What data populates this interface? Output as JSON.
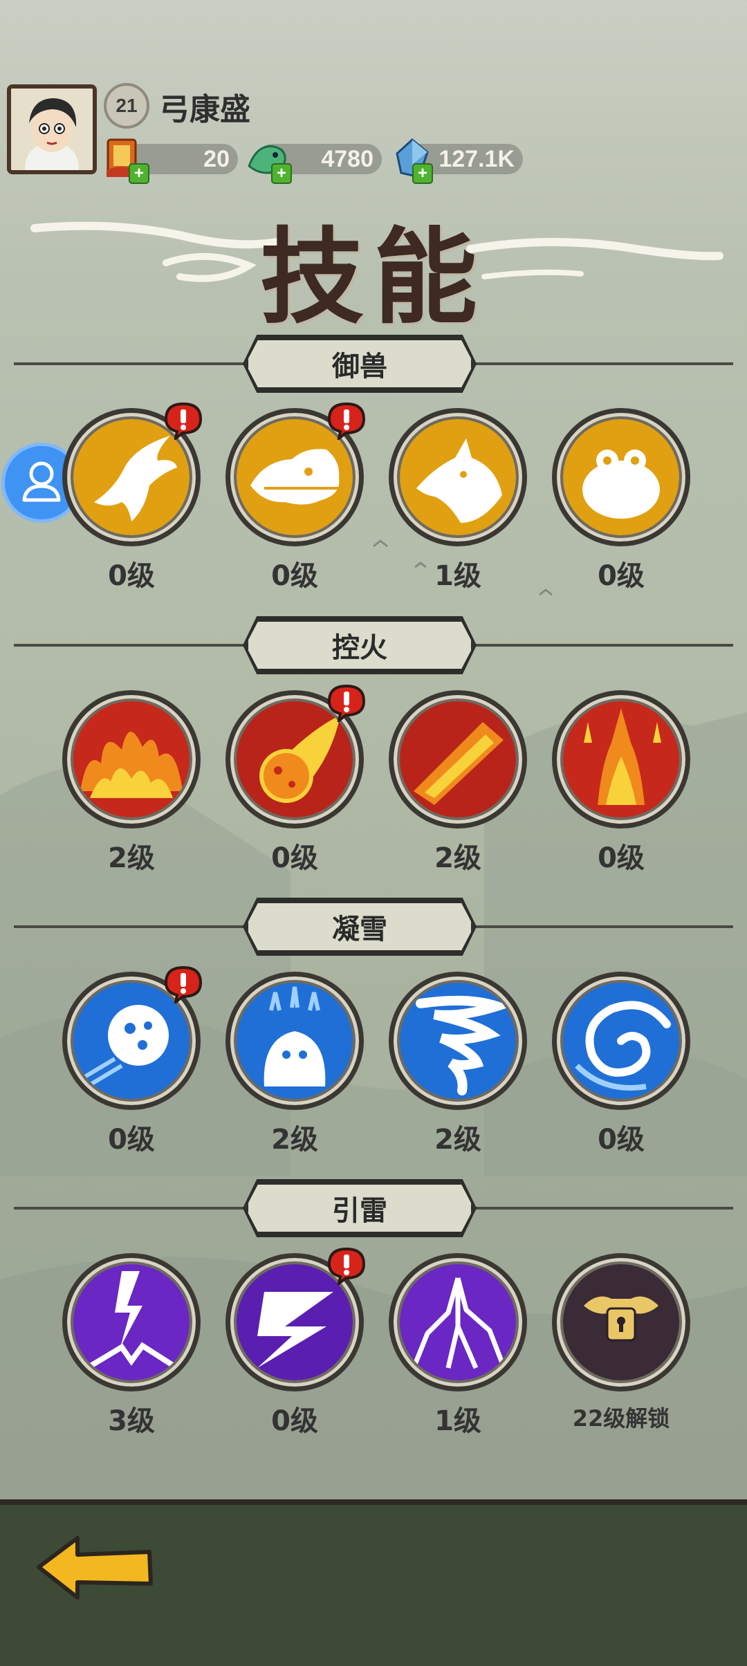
{
  "player": {
    "level": "21",
    "name": "弓康盛"
  },
  "resources": [
    {
      "icon": "scroll-pack-icon",
      "value": "20"
    },
    {
      "icon": "jade-dragon-icon",
      "value": "4780"
    },
    {
      "icon": "crystal-icon",
      "value": "127.1K"
    }
  ],
  "title": "技能",
  "sections": [
    {
      "label": "御兽",
      "skills": [
        {
          "icon": "eagle-icon",
          "level": "0级",
          "alert": true
        },
        {
          "icon": "dragon-icon",
          "level": "0级",
          "alert": true
        },
        {
          "icon": "wolf-icon",
          "level": "1级",
          "alert": false
        },
        {
          "icon": "toad-icon",
          "level": "0级",
          "alert": false
        }
      ]
    },
    {
      "label": "控火",
      "skills": [
        {
          "icon": "flame-wall-icon",
          "level": "2级",
          "alert": false
        },
        {
          "icon": "fireball-icon",
          "level": "0级",
          "alert": true
        },
        {
          "icon": "fire-beam-icon",
          "level": "2级",
          "alert": false
        },
        {
          "icon": "fire-pillar-icon",
          "level": "0级",
          "alert": false
        }
      ]
    },
    {
      "label": "凝雪",
      "skills": [
        {
          "icon": "snowball-icon",
          "level": "0级",
          "alert": true
        },
        {
          "icon": "frost-spirit-icon",
          "level": "2级",
          "alert": false
        },
        {
          "icon": "ice-tornado-icon",
          "level": "2级",
          "alert": false
        },
        {
          "icon": "blizzard-vortex-icon",
          "level": "0级",
          "alert": false
        }
      ]
    },
    {
      "label": "引雷",
      "skills": [
        {
          "icon": "lightning-strike-icon",
          "level": "3级",
          "alert": false
        },
        {
          "icon": "lightning-bolt-icon",
          "level": "0级",
          "alert": true
        },
        {
          "icon": "thunderstorm-icon",
          "level": "1级",
          "alert": false
        },
        {
          "icon": "lock-icon",
          "level": "22级解锁",
          "alert": false
        }
      ]
    }
  ],
  "colors": {
    "gold": "#e0a012",
    "fire": "#c6281b",
    "ice": "#1f6fd6",
    "thunder": "#6a27c4",
    "locked": "#3a2b36",
    "alert": "#d8231b"
  }
}
